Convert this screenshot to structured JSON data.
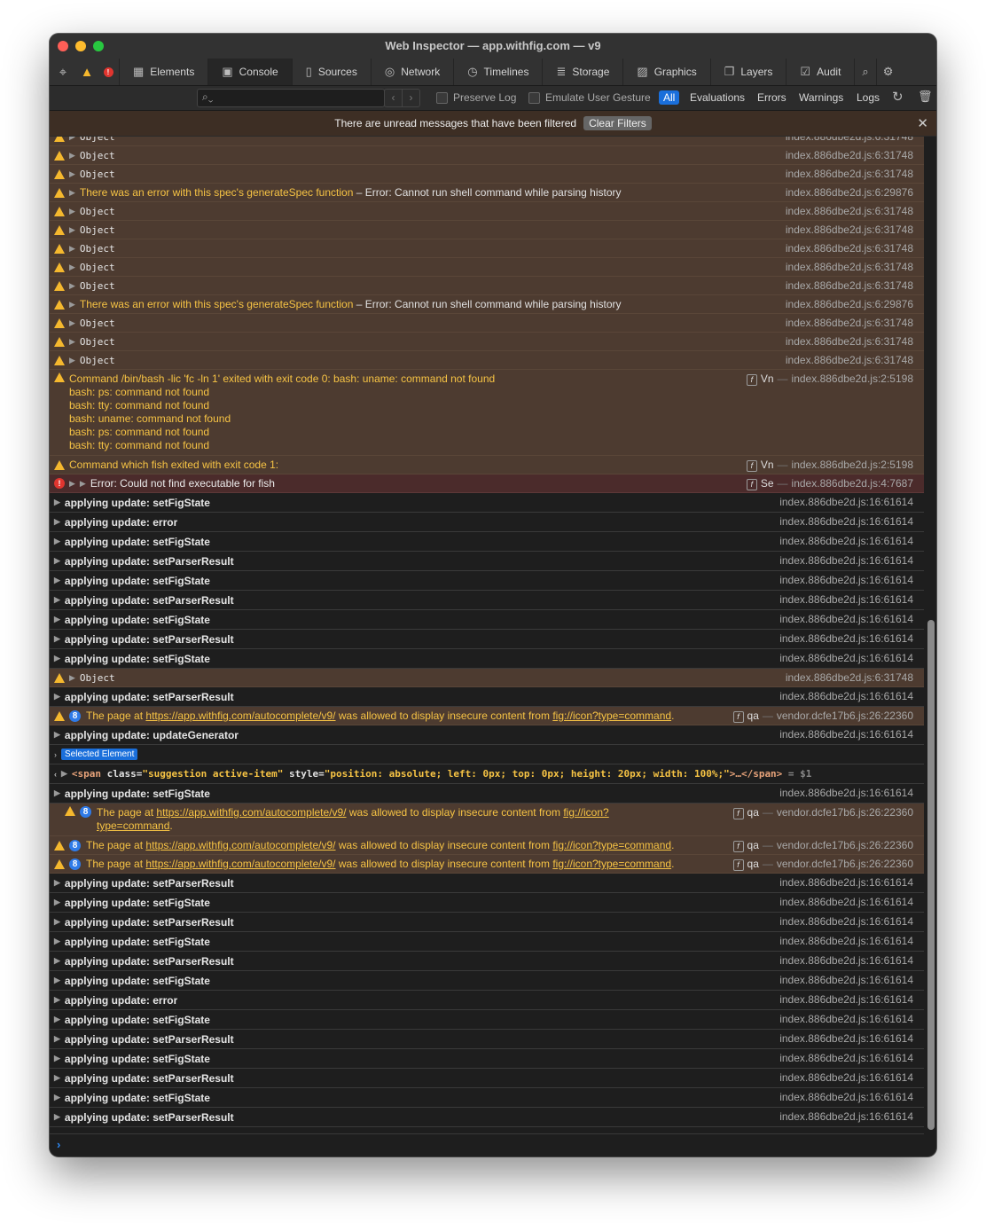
{
  "window": {
    "title": "Web Inspector — app.withfig.com — v9"
  },
  "tabs": [
    {
      "label": "Elements",
      "icon": "elements-icon"
    },
    {
      "label": "Console",
      "icon": "console-icon"
    },
    {
      "label": "Sources",
      "icon": "sources-icon"
    },
    {
      "label": "Network",
      "icon": "network-icon"
    },
    {
      "label": "Timelines",
      "icon": "timelines-icon"
    },
    {
      "label": "Storage",
      "icon": "storage-icon"
    },
    {
      "label": "Graphics",
      "icon": "graphics-icon"
    },
    {
      "label": "Layers",
      "icon": "layers-icon"
    },
    {
      "label": "Audit",
      "icon": "audit-icon"
    }
  ],
  "active_tab": "Console",
  "toolbar": {
    "filter_placeholder": "",
    "preserve_log": "Preserve Log",
    "emulate_gesture": "Emulate User Gesture",
    "levels": [
      "All",
      "Evaluations",
      "Errors",
      "Warnings",
      "Logs"
    ],
    "active_level": "All"
  },
  "banner": {
    "text": "There are unread messages that have been filtered",
    "button": "Clear Filters"
  },
  "common": {
    "object": "Object",
    "src_31748": "index.886dbe2d.js:6:31748",
    "src_29876": "index.886dbe2d.js:6:29876",
    "src_61614": "index.886dbe2d.js:16:61614",
    "src_5198": "index.886dbe2d.js:2:5198",
    "src_7687": "index.886dbe2d.js:4:7687",
    "src_22360": "vendor.dcfe17b6.js:26:22360",
    "spec_error": "There was an error with this spec's generateSpec function",
    "spec_error_detail": " – Error: Cannot run shell command while parsing history",
    "fn_vn": "Vn",
    "fn_se": "Se",
    "fn_qa": "qa",
    "sep": "—",
    "badge_count": "8",
    "insecure_prefix": "The page at ",
    "insecure_url": "https://app.withfig.com/autocomplete/v9/",
    "insecure_mid": " was allowed to display insecure content from ",
    "insecure_src": "fig://icon?type=command",
    "insecure_src_a": "fig://icon?",
    "insecure_src_b": "type=command",
    "period": "."
  },
  "messages": {
    "cmd_bash_lines": [
      "Command /bin/bash -lic 'fc -ln 1' exited with exit code 0: bash: uname: command not found",
      "bash: ps: command not found",
      "bash: tty: command not found",
      "bash: uname: command not found",
      "bash: ps: command not found",
      "bash: tty: command not found"
    ],
    "cmd_fish": "Command which fish exited with exit code 1:",
    "error_fish": "Error: Could not find executable for fish",
    "selected_element": "Selected Element",
    "selected_code": {
      "open": "<span ",
      "class_attr": "class=",
      "class_val": "\"suggestion active-item\"",
      "style_attr": " style=",
      "style_val": "\"position: absolute; left: 0px; top: 0px; height: 20px; width: 100%;\"",
      "close": ">…</span>",
      "ref": " = $1"
    }
  },
  "logs": {
    "setFigState": "applying update: setFigState",
    "error": "applying update: error",
    "setParserResult": "applying update: setParserResult",
    "updateGenerator": "applying update: updateGenerator"
  }
}
